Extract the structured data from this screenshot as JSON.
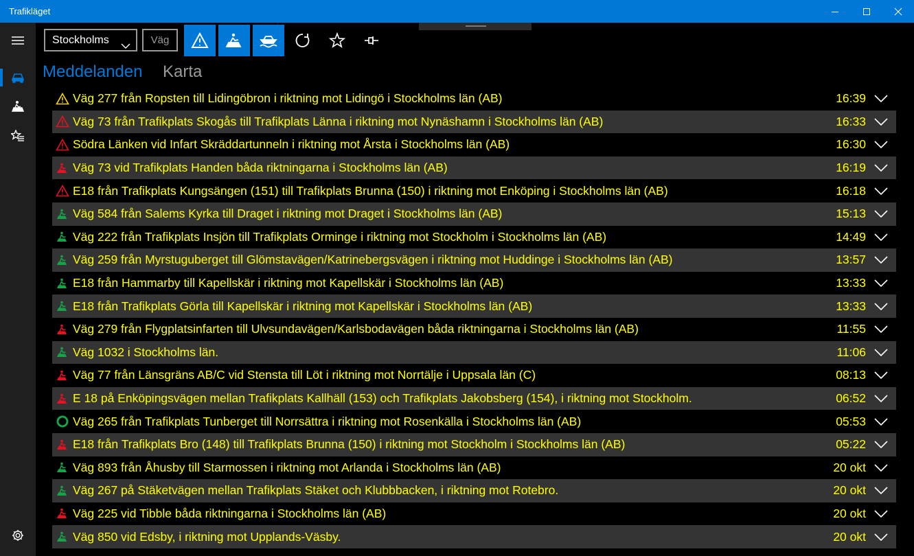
{
  "window": {
    "title": "Trafikläget"
  },
  "toolbar": {
    "county": "Stockholms",
    "road_placeholder": "Väg"
  },
  "tabs": [
    {
      "label": "Meddelanden",
      "active": true
    },
    {
      "label": "Karta",
      "active": false
    }
  ],
  "colors": {
    "accent": "#0078d7",
    "text": "#ffff00",
    "warning_yellow": "#ffd800",
    "warning_red": "#e81123",
    "roadwork_red": "#e81123",
    "roadwork_green": "#16a34a",
    "alt_row": "#343434"
  },
  "messages": [
    {
      "icon": "warning-yellow",
      "text": "Väg 277 från Ropsten till Lidingöbron i riktning mot Lidingö i Stockholms län (AB)",
      "time": "16:39"
    },
    {
      "icon": "warning-red",
      "text": "Väg 73 från Trafikplats Skogås till Trafikplats Länna i riktning mot Nynäshamn i Stockholms län (AB)",
      "time": "16:33"
    },
    {
      "icon": "warning-red",
      "text": "Södra Länken vid Infart Skräddartunneln i riktning mot Årsta i Stockholms län (AB)",
      "time": "16:30"
    },
    {
      "icon": "roadwork-red",
      "text": "Väg 73 vid Trafikplats Handen båda riktningarna i Stockholms län (AB)",
      "time": "16:19"
    },
    {
      "icon": "warning-red",
      "text": "E18 från Trafikplats Kungsängen (151) till Trafikplats Brunna (150) i riktning mot Enköping i Stockholms län (AB)",
      "time": "16:18"
    },
    {
      "icon": "roadwork-green",
      "text": "Väg 584 från Salems Kyrka till Draget i riktning mot Draget i Stockholms län (AB)",
      "time": "15:13"
    },
    {
      "icon": "roadwork-green",
      "text": "Väg 222 från Trafikplats Insjön till Trafikplats Orminge i riktning mot Stockholm i Stockholms län (AB)",
      "time": "14:49"
    },
    {
      "icon": "roadwork-green",
      "text": "Väg 259 från Myrstuguberget till Glömstavägen/Katrinebergsvägen i riktning mot Huddinge i Stockholms län (AB)",
      "time": "13:57"
    },
    {
      "icon": "roadwork-green",
      "text": "E18 från Hammarby till Kapellskär i riktning mot Kapellskär i Stockholms län (AB)",
      "time": "13:33"
    },
    {
      "icon": "roadwork-green",
      "text": "E18 från Trafikplats Görla till Kapellskär i riktning mot Kapellskär i Stockholms län (AB)",
      "time": "13:33"
    },
    {
      "icon": "roadwork-red",
      "text": "Väg 279 från Flygplatsinfarten till Ulvsundavägen/Karlsbodavägen båda riktningarna i Stockholms län (AB)",
      "time": "11:55"
    },
    {
      "icon": "roadwork-green",
      "text": "Väg 1032 i Stockholms län.",
      "time": "11:06"
    },
    {
      "icon": "roadwork-red",
      "text": "Väg 77 från Länsgräns AB/C vid Stensta till Löt i riktning mot Norrtälje i Uppsala län (C)",
      "time": "08:13"
    },
    {
      "icon": "roadwork-red",
      "text": "E 18 på Enköpingsvägen mellan Trafikplats Kallhäll (153) och Trafikplats Jakobsberg (154), i riktning mot Stockholm.",
      "time": "06:52"
    },
    {
      "icon": "ring-green",
      "text": "Väg 265 från Trafikplats Tunberget till Norrsättra i riktning mot Rosenkälla i Stockholms län (AB)",
      "time": "05:53"
    },
    {
      "icon": "roadwork-red",
      "text": "E18 från Trafikplats Bro (148) till Trafikplats Brunna (150) i riktning mot Stockholm i Stockholms län (AB)",
      "time": "05:22"
    },
    {
      "icon": "roadwork-green",
      "text": "Väg 893 från Åhusby till Starmossen i riktning mot Arlanda i Stockholms län (AB)",
      "time": "20 okt"
    },
    {
      "icon": "roadwork-green",
      "text": "Väg 267 på Stäketvägen mellan Trafikplats Stäket och Klubbbacken, i riktning mot Rotebro.",
      "time": "20 okt"
    },
    {
      "icon": "roadwork-red",
      "text": "Väg 225 vid Tibble båda riktningarna i Stockholms län (AB)",
      "time": "20 okt"
    },
    {
      "icon": "roadwork-green",
      "text": "Väg 850 vid Edsby, i riktning mot Upplands-Väsby.",
      "time": "20 okt"
    }
  ]
}
